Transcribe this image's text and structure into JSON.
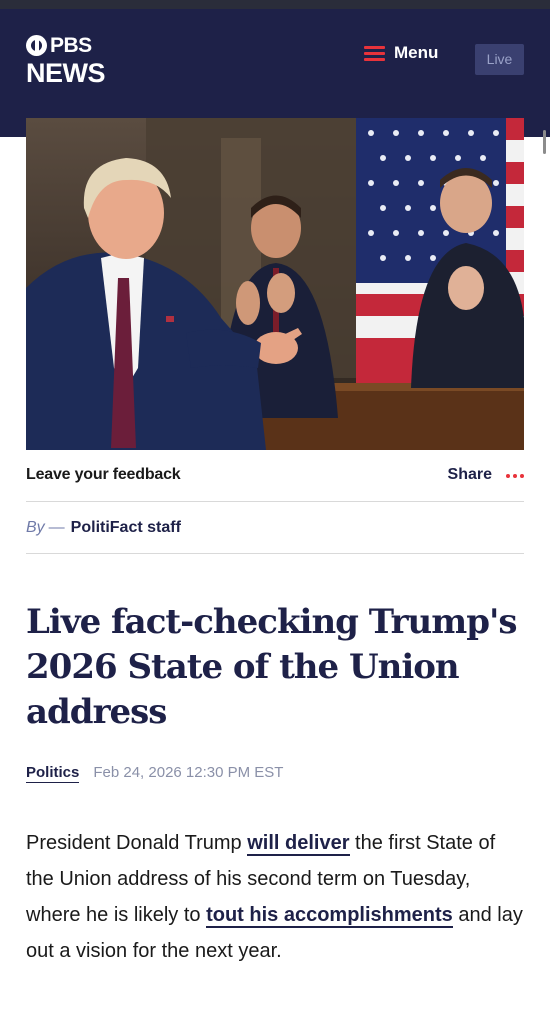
{
  "header": {
    "logo_top": "PBS",
    "logo_bottom": "NEWS",
    "menu_label": "Menu",
    "live_label": "Live"
  },
  "hero": {
    "alt": "President speaking at State of the Union with two men applauding behind him"
  },
  "utility": {
    "feedback_label": "Leave your feedback",
    "share_label": "Share"
  },
  "byline": {
    "by": "By",
    "dash": "—",
    "author": "PolitiFact staff"
  },
  "article": {
    "title": "Live fact-checking Trump's 2026 State of the Union address",
    "category": "Politics",
    "date": "Feb 24, 2026 12:30 PM EST",
    "body": {
      "p1_a": "President Donald Trump ",
      "link1": "will deliver",
      "p1_b": " the first State of the Union address of his second term on Tuesday, where he is likely to ",
      "link2": "tout his accomplishments",
      "p1_c": " and lay out a vision for the next year."
    }
  },
  "colors": {
    "header_bg": "#1e2148",
    "accent_red": "#e8333b",
    "text_navy": "#1e2148"
  }
}
